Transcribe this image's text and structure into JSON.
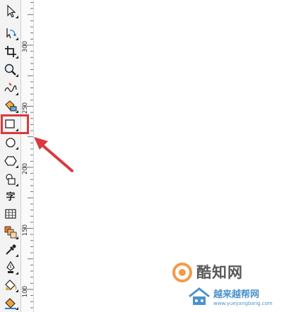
{
  "toolbox": {
    "tools": [
      {
        "name": "pick-tool",
        "icon": "pointer-arrow-icon"
      },
      {
        "name": "shape-tool",
        "icon": "node-edit-icon"
      },
      {
        "name": "crop-tool",
        "icon": "crop-icon"
      },
      {
        "name": "zoom-tool",
        "icon": "magnifier-icon"
      },
      {
        "name": "freehand-tool",
        "icon": "freehand-curve-icon"
      },
      {
        "name": "smart-fill-tool",
        "icon": "smart-fill-icon"
      },
      {
        "name": "rectangle-tool",
        "icon": "rectangle-icon"
      },
      {
        "name": "ellipse-tool",
        "icon": "ellipse-icon"
      },
      {
        "name": "polygon-tool",
        "icon": "polygon-icon"
      },
      {
        "name": "basic-shapes-tool",
        "icon": "basic-shapes-icon"
      },
      {
        "name": "text-tool",
        "icon": "text-glyph-icon",
        "label": "字"
      },
      {
        "name": "table-tool",
        "icon": "table-grid-icon"
      },
      {
        "name": "interactive-tool",
        "icon": "blend-icon"
      },
      {
        "name": "eyedropper-tool",
        "icon": "eyedropper-icon"
      },
      {
        "name": "outline-pen-tool",
        "icon": "pen-nib-icon"
      },
      {
        "name": "fill-tool",
        "icon": "paint-bucket-icon"
      },
      {
        "name": "interactive-fill-tool",
        "icon": "interactive-fill-icon"
      }
    ]
  },
  "ruler": {
    "labels": [
      "300",
      "250",
      "200",
      "150",
      "100"
    ]
  },
  "watermark": {
    "title": "酷知网",
    "subtitle": "越来越帮网",
    "url": "www.yueyangbang.com"
  },
  "colors": {
    "highlight": "#d9393d",
    "arrow": "#d9393d",
    "watermark_blue": "#2c7fc2"
  }
}
